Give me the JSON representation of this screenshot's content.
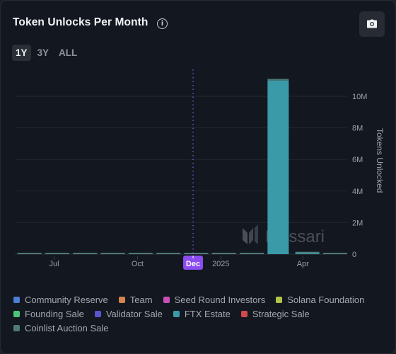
{
  "header": {
    "title": "Token Unlocks Per Month",
    "info_icon": "info-circle-icon",
    "screenshot_icon": "camera-icon"
  },
  "range_tabs": [
    {
      "label": "1Y",
      "active": true
    },
    {
      "label": "3Y",
      "active": false
    },
    {
      "label": "ALL",
      "active": false
    }
  ],
  "watermark": "Messari",
  "chart_data": {
    "type": "bar",
    "stacked": true,
    "title": "Token Unlocks Per Month",
    "xlabel": "",
    "ylabel": "Tokens Unlocked",
    "ylim": [
      0,
      11500000
    ],
    "y_ticks": [
      {
        "value": 0,
        "label": "0"
      },
      {
        "value": 2000000,
        "label": "2M"
      },
      {
        "value": 4000000,
        "label": "4M"
      },
      {
        "value": 6000000,
        "label": "6M"
      },
      {
        "value": 8000000,
        "label": "8M"
      },
      {
        "value": 10000000,
        "label": "10M"
      }
    ],
    "grid": true,
    "y_axis_side": "right",
    "categories": [
      "2024-06",
      "2024-07",
      "2024-08",
      "2024-09",
      "2024-10",
      "2024-11",
      "2024-12",
      "2025-01",
      "2025-02",
      "2025-03",
      "2025-04",
      "2025-05"
    ],
    "x_ticks": [
      {
        "index": 0.9,
        "label": "Jul"
      },
      {
        "index": 3.9,
        "label": "Oct"
      },
      {
        "index": 5.9,
        "label": "Dec",
        "highlight": true
      },
      {
        "index": 6.9,
        "label": "2025"
      },
      {
        "index": 9.85,
        "label": "Apr"
      }
    ],
    "crosshair_category": "Dec",
    "series": [
      {
        "name": "Community Reserve",
        "color": "#4a7fd4",
        "values": [
          0,
          0,
          0,
          0,
          0,
          0,
          0,
          0,
          0,
          0,
          0,
          0
        ]
      },
      {
        "name": "Team",
        "color": "#d4844f",
        "values": [
          0,
          0,
          0,
          0,
          0,
          0,
          0,
          0,
          0,
          0,
          0,
          0
        ]
      },
      {
        "name": "Seed Round Investors",
        "color": "#c94fb4",
        "values": [
          0,
          0,
          0,
          0,
          0,
          0,
          0,
          0,
          0,
          0,
          0,
          0
        ]
      },
      {
        "name": "Solana Foundation",
        "color": "#b3c444",
        "values": [
          0,
          0,
          0,
          0,
          0,
          0,
          0,
          0,
          0,
          0,
          0,
          0
        ]
      },
      {
        "name": "Founding Sale",
        "color": "#4cc47a",
        "values": [
          0,
          0,
          0,
          0,
          0,
          0,
          0,
          0,
          0,
          0,
          0,
          0
        ]
      },
      {
        "name": "Validator Sale",
        "color": "#5a55cf",
        "values": [
          0,
          0,
          0,
          0,
          0,
          0,
          0,
          0,
          0,
          0,
          0,
          0
        ]
      },
      {
        "name": "FTX Estate",
        "color": "#3a9aa8",
        "values": [
          0,
          0,
          0,
          0,
          0,
          0,
          0,
          0,
          0,
          11000000,
          60000,
          0
        ]
      },
      {
        "name": "Strategic Sale",
        "color": "#d04a4a",
        "values": [
          0,
          0,
          0,
          0,
          0,
          0,
          0,
          0,
          0,
          0,
          0,
          0
        ]
      },
      {
        "name": "Coinlist Auction Sale",
        "color": "#4e7a78",
        "values": [
          60000,
          60000,
          60000,
          60000,
          60000,
          60000,
          60000,
          60000,
          60000,
          100000,
          60000,
          60000
        ]
      }
    ]
  }
}
